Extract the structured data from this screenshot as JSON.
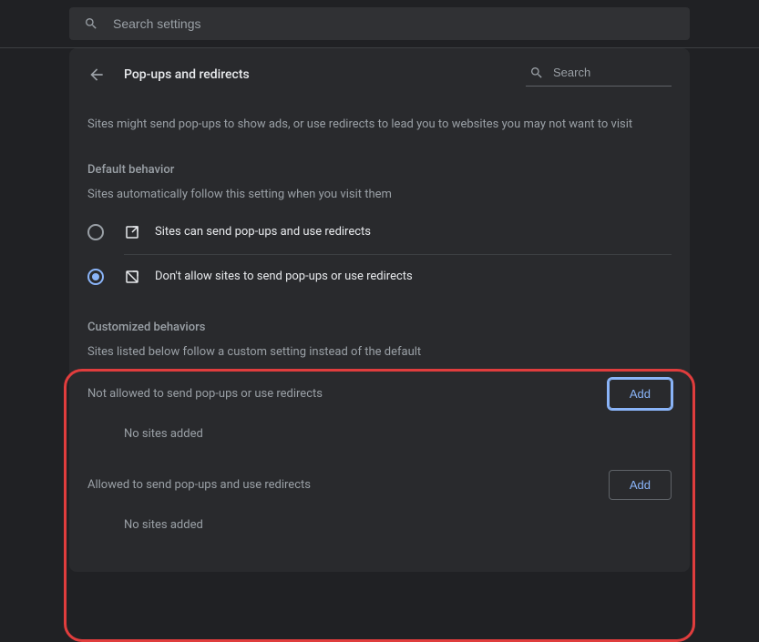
{
  "topSearch": {
    "placeholder": "Search settings"
  },
  "header": {
    "title": "Pop-ups and redirects",
    "searchPlaceholder": "Search"
  },
  "intro": "Sites might send pop-ups to show ads, or use redirects to lead you to websites you may not want to visit",
  "defaultBehavior": {
    "heading": "Default behavior",
    "sub": "Sites automatically follow this setting when you visit them",
    "options": [
      {
        "label": "Sites can send pop-ups and use redirects",
        "selected": false
      },
      {
        "label": "Don't allow sites to send pop-ups or use redirects",
        "selected": true
      }
    ]
  },
  "customized": {
    "heading": "Customized behaviors",
    "sub": "Sites listed below follow a custom setting instead of the default",
    "notAllowed": {
      "label": "Not allowed to send pop-ups or use redirects",
      "empty": "No sites added",
      "addLabel": "Add"
    },
    "allowed": {
      "label": "Allowed to send pop-ups and use redirects",
      "empty": "No sites added",
      "addLabel": "Add"
    }
  }
}
